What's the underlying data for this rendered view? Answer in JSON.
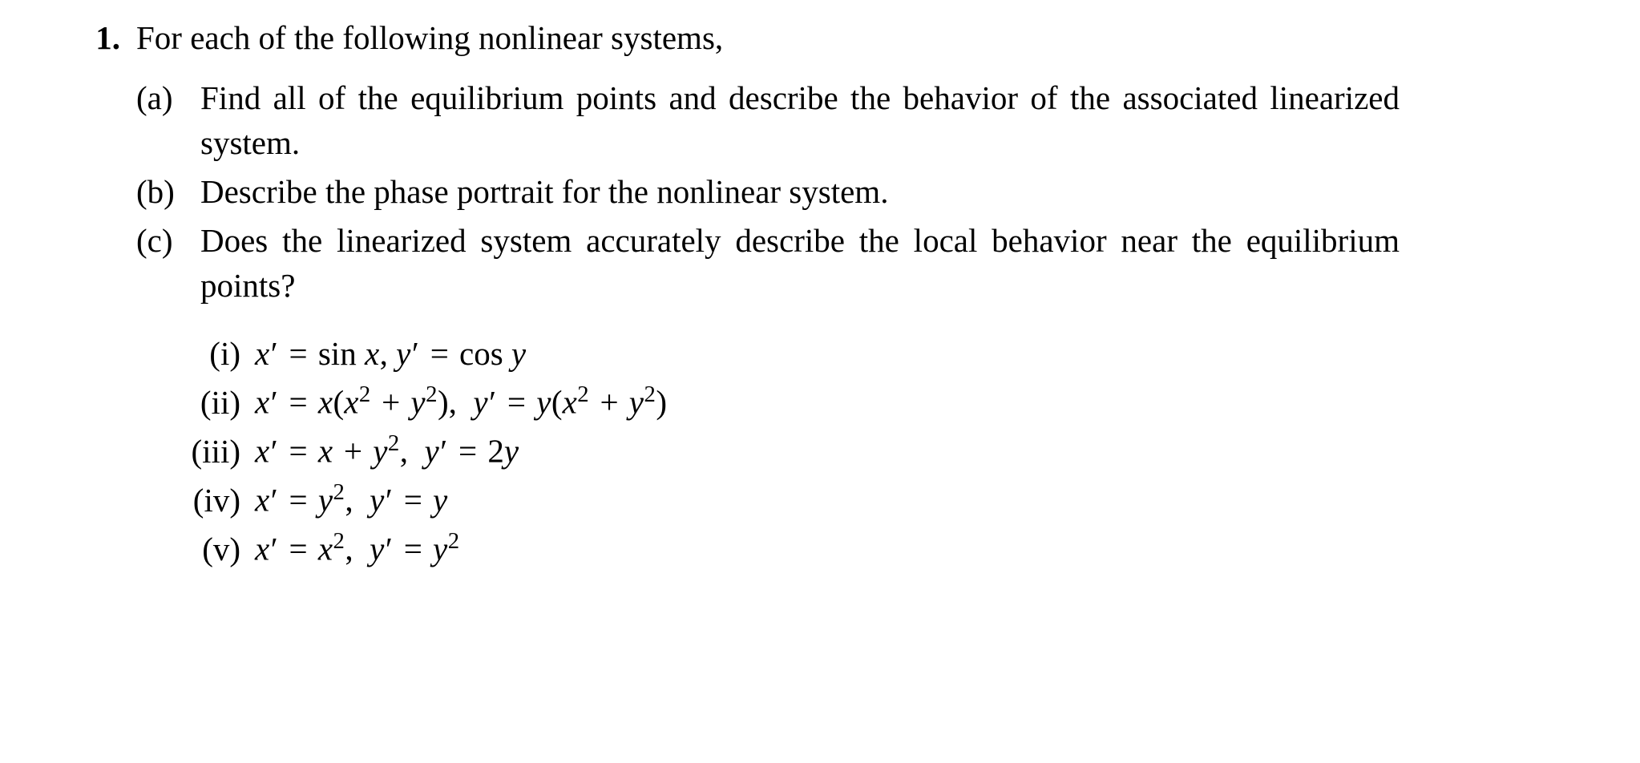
{
  "problem": {
    "number": "1.",
    "stem": "For each of the following nonlinear systems,",
    "parts": [
      {
        "label": "(a)",
        "text": "Find all of the equilibrium points and describe the behavior of the associated linearized system."
      },
      {
        "label": "(b)",
        "text": "Describe the phase portrait for the nonlinear system."
      },
      {
        "label": "(c)",
        "text": "Does the linearized system accurately describe the local behavior near the equilibrium points?"
      }
    ],
    "subitems": [
      {
        "label": "(i)",
        "eq1_lhs": "x′ = ",
        "eq1_rhs_pre": "sin ",
        "eq1_rhs_var": "x",
        "sep": ",  ",
        "eq2_lhs": "y′ = ",
        "eq2_rhs_pre": "cos ",
        "eq2_rhs_var": "y"
      },
      {
        "label": "(ii)",
        "eq": "x′ = x(x² + y²),  y′ = y(x² + y²)"
      },
      {
        "label": "(iii)",
        "eq": "x′ = x + y²,  y′ = 2y"
      },
      {
        "label": "(iv)",
        "eq": "x′ = y²,  y′ = y"
      },
      {
        "label": "(v)",
        "eq": "x′ = x²,  y′ = y²"
      }
    ]
  }
}
